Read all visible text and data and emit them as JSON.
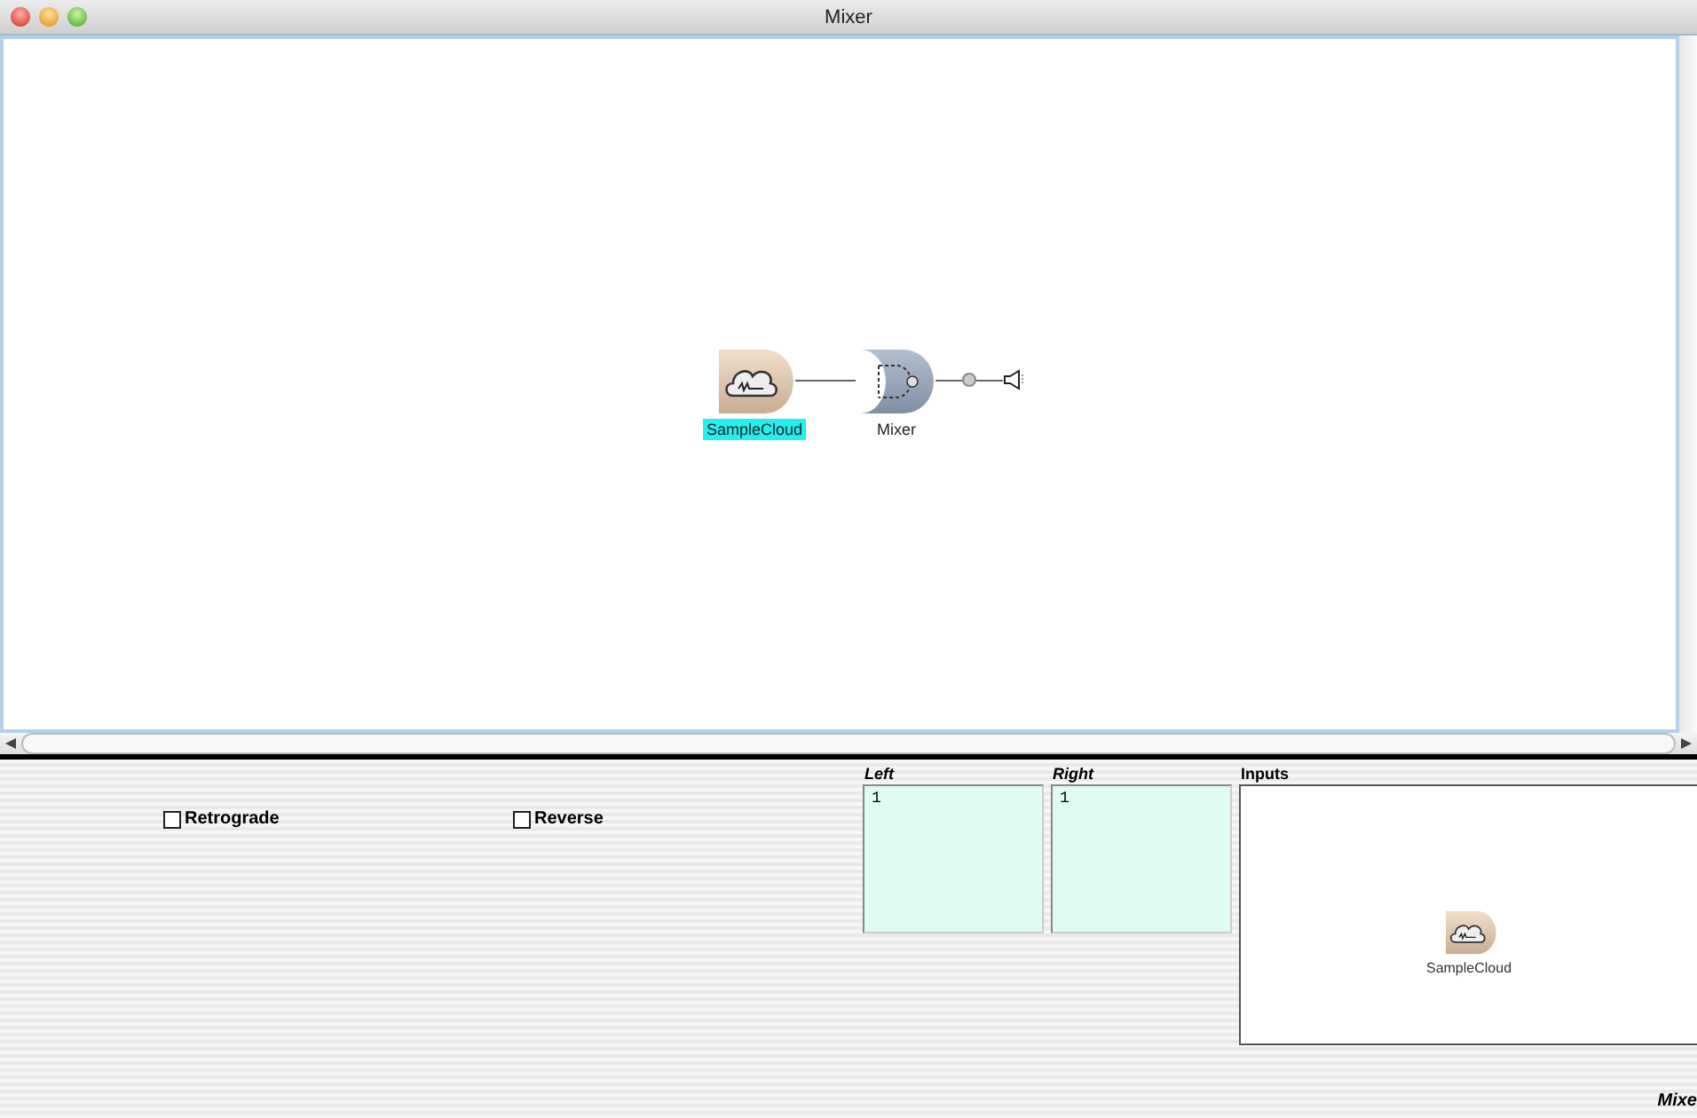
{
  "window": {
    "title": "Mixer"
  },
  "canvas": {
    "nodes": [
      {
        "kind": "generator",
        "label": "SampleCloud",
        "selected": true
      },
      {
        "kind": "mixer",
        "label": "Mixer",
        "selected": false
      }
    ]
  },
  "options": [
    {
      "label": "Retrograde",
      "checked": false
    },
    {
      "label": "Reverse",
      "checked": false
    }
  ],
  "gains": [
    {
      "label": "Left",
      "value": "1"
    },
    {
      "label": "Right",
      "value": "1"
    }
  ],
  "inputs": {
    "title": "Inputs",
    "items": [
      {
        "kind": "generator",
        "label": "SampleCloud"
      }
    ]
  },
  "footer": "Mixe"
}
